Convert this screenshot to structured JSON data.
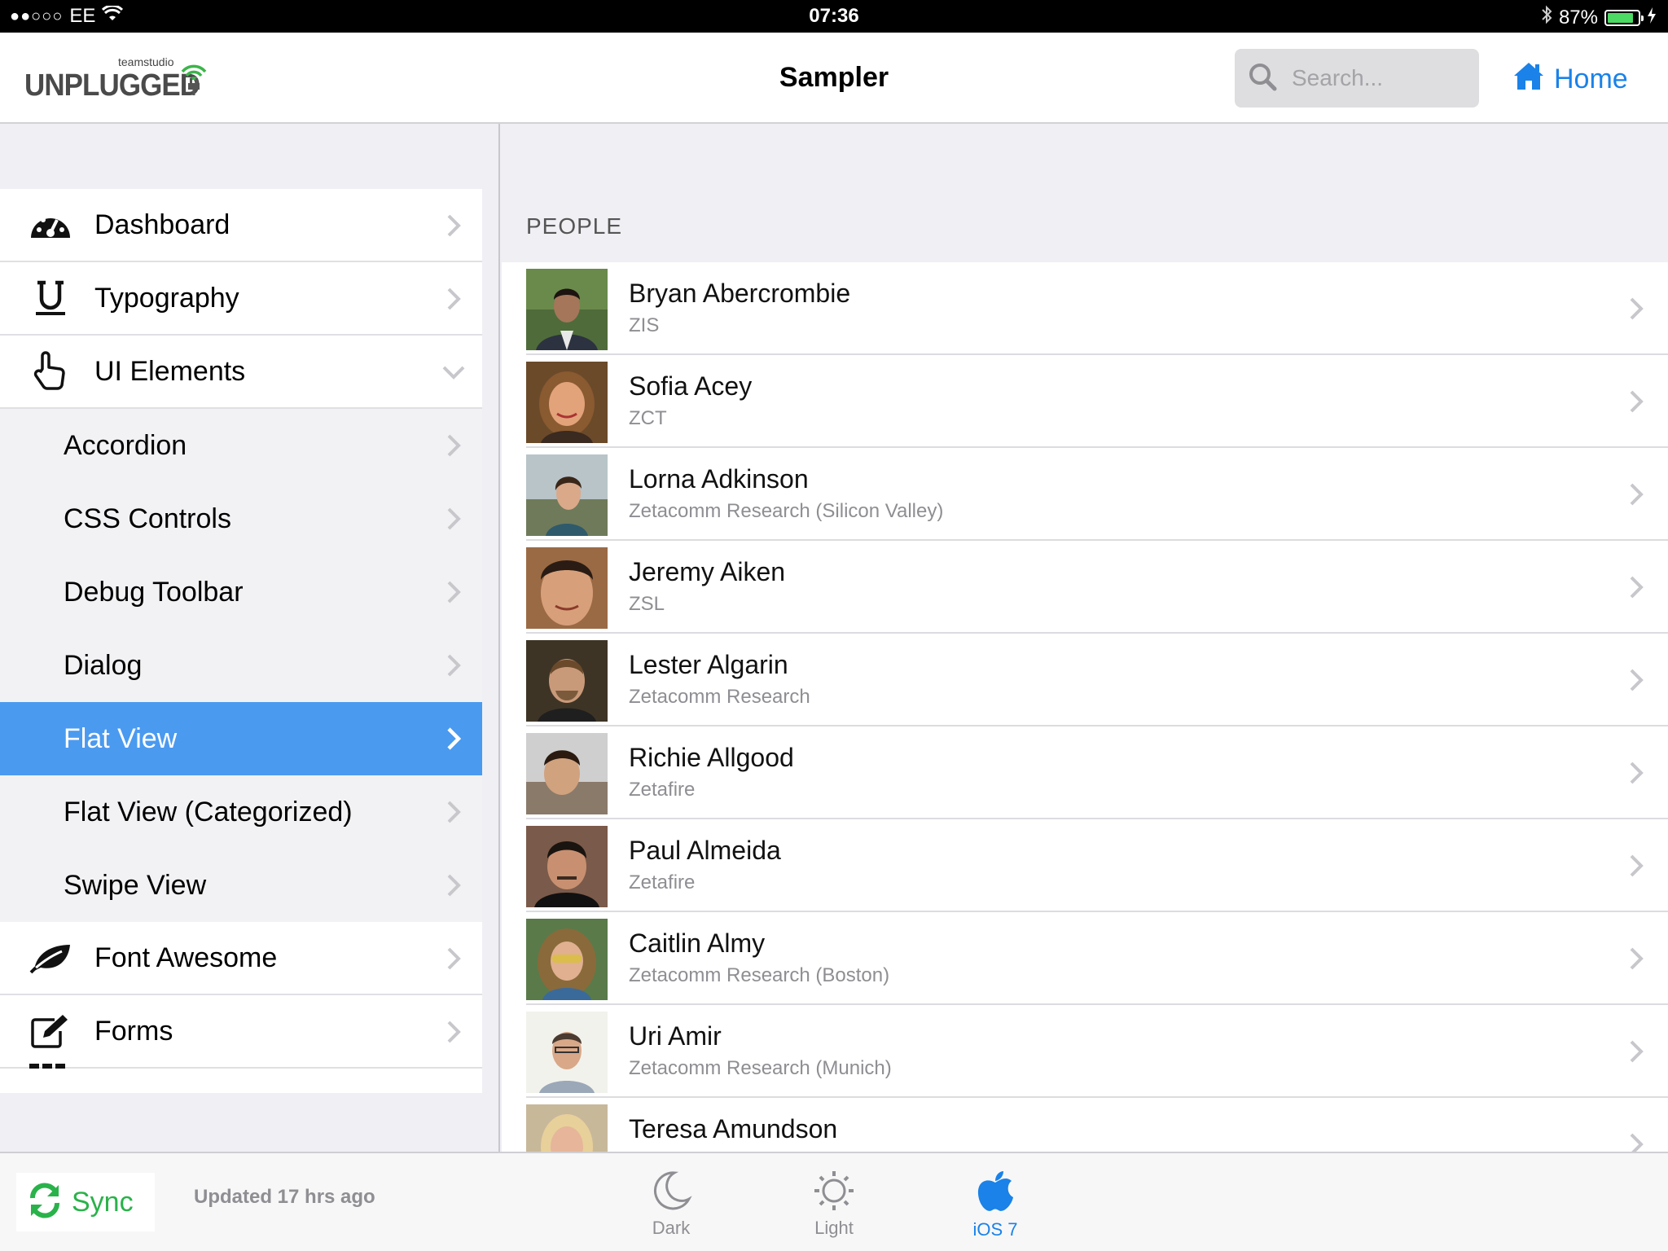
{
  "status_bar": {
    "signal": "●●○○○",
    "carrier": "EE",
    "time": "07:36",
    "battery": "87%",
    "battery_level": 0.87
  },
  "header": {
    "logo_small": "teamstudio",
    "logo_big": "UNPLUGGED",
    "title": "Sampler",
    "search_placeholder": "Search...",
    "home_label": "Home"
  },
  "sidebar": {
    "items": [
      {
        "label": "Dashboard"
      },
      {
        "label": "Typography"
      },
      {
        "label": "UI Elements"
      },
      {
        "label": "Accordion"
      },
      {
        "label": "CSS Controls"
      },
      {
        "label": "Debug Toolbar"
      },
      {
        "label": "Dialog"
      },
      {
        "label": "Flat View"
      },
      {
        "label": "Flat View (Categorized)"
      },
      {
        "label": "Swipe View"
      },
      {
        "label": "Font Awesome"
      },
      {
        "label": "Forms"
      }
    ]
  },
  "people": {
    "section_title": "PEOPLE",
    "rows": [
      {
        "name": "Bryan Abercrombie",
        "company": "ZIS"
      },
      {
        "name": "Sofia Acey",
        "company": "ZCT"
      },
      {
        "name": "Lorna Adkinson",
        "company": "Zetacomm Research (Silicon Valley)"
      },
      {
        "name": "Jeremy Aiken",
        "company": "ZSL"
      },
      {
        "name": "Lester Algarin",
        "company": "Zetacomm Research"
      },
      {
        "name": "Richie Allgood",
        "company": "Zetafire"
      },
      {
        "name": "Paul Almeida",
        "company": "Zetafire"
      },
      {
        "name": "Caitlin Almy",
        "company": "Zetacomm Research (Boston)"
      },
      {
        "name": "Uri Amir",
        "company": "Zetacomm Research (Munich)"
      },
      {
        "name": "Teresa Amundson",
        "company": ""
      }
    ]
  },
  "bottom_bar": {
    "sync_label": "Sync",
    "updated_text": "Updated 17 hrs ago",
    "themes": [
      {
        "label": "Dark"
      },
      {
        "label": "Light"
      },
      {
        "label": "iOS 7"
      }
    ]
  },
  "colors": {
    "accent": "#1a82e8",
    "active_row": "#4a9af0",
    "sync_green": "#2ab24a",
    "battery_green": "#4cd964"
  }
}
